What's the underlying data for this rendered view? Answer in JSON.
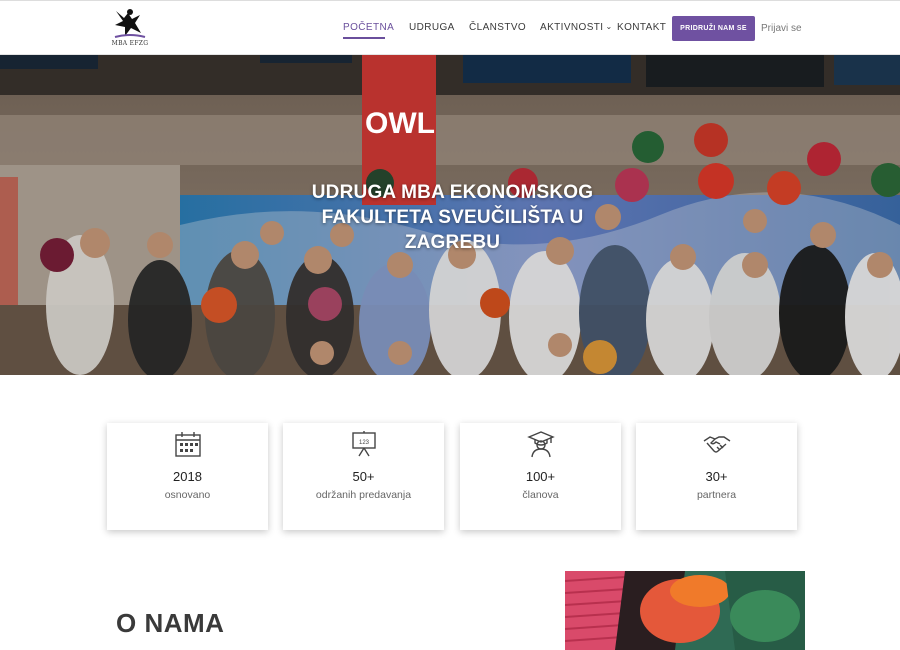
{
  "nav": {
    "logo_text": "MBA EFZG",
    "items": [
      {
        "label": "Početna",
        "active": true
      },
      {
        "label": "Udruga"
      },
      {
        "label": "Članstvo"
      },
      {
        "label": "Aktivnosti",
        "has_dropdown": true
      },
      {
        "label": "Kontakt"
      }
    ],
    "join_button": "Pridruži nam se",
    "login_link": "Prijavi se",
    "accent_color": "#6f51a1"
  },
  "hero": {
    "title": "Udruga MBA Ekonomskog Fakulteta Sveučilišta u Zagrebu",
    "banner_text": "OWL"
  },
  "stats": [
    {
      "icon": "calendar-icon",
      "value": "2018",
      "label": "osnovano"
    },
    {
      "icon": "presentation-board-icon",
      "value": "50+",
      "label": "održanih predavanja",
      "board_text": "123"
    },
    {
      "icon": "graduate-icon",
      "value": "100+",
      "label": "članova"
    },
    {
      "icon": "handshake-icon",
      "value": "30+",
      "label": "partnera"
    }
  ],
  "about": {
    "heading": "O NAMA"
  }
}
